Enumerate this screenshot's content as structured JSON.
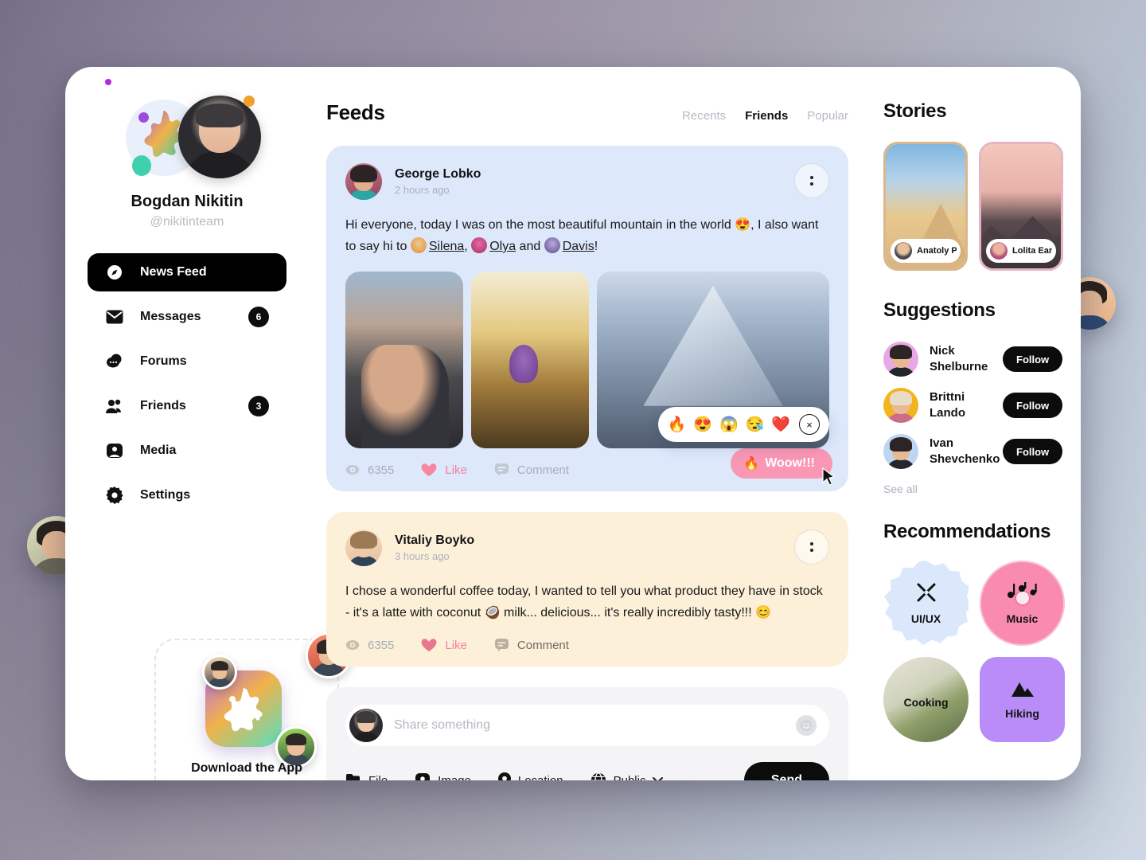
{
  "profile": {
    "name": "Bogdan Nikitin",
    "handle": "@nikitinteam"
  },
  "nav": {
    "items": [
      {
        "label": "News Feed",
        "icon": "compass-icon",
        "badge": "",
        "active": true
      },
      {
        "label": "Messages",
        "icon": "mail-icon",
        "badge": "6",
        "active": false
      },
      {
        "label": "Forums",
        "icon": "chat-icon",
        "badge": "",
        "active": false
      },
      {
        "label": "Friends",
        "icon": "people-icon",
        "badge": "3",
        "active": false
      },
      {
        "label": "Media",
        "icon": "image-icon",
        "badge": "",
        "active": false
      },
      {
        "label": "Settings",
        "icon": "gear-icon",
        "badge": "",
        "active": false
      }
    ]
  },
  "download_card": {
    "title": "Download the App",
    "icon": "app-logo-splash-icon"
  },
  "feed": {
    "title": "Feeds",
    "tabs": [
      {
        "label": "Recents",
        "active": false
      },
      {
        "label": "Friends",
        "active": true
      },
      {
        "label": "Popular",
        "active": false
      }
    ],
    "posts": [
      {
        "author": "George Lobko",
        "time": "2 hours ago",
        "text_part1": "Hi everyone, today I was on the most beautiful mountain in the world ",
        "emoji1": "😍",
        "text_part2": ", I also want to say hi to ",
        "mention1": "Silena",
        "text_part3": ", ",
        "mention2": "Olya",
        "text_part4": " and ",
        "mention3": "Davis",
        "text_part5": "!",
        "views": "6355",
        "like_label": "Like",
        "comment_label": "Comment",
        "has_gallery": true,
        "reactions": [
          "🔥",
          "😍",
          "😱",
          "😪",
          "❤️"
        ],
        "reaction_close": "×",
        "woow_label": "Woow!!!",
        "woow_emoji": "🔥"
      },
      {
        "author": "Vitaliy Boyko",
        "time": "3 hours ago",
        "text_line1": "I chose a wonderful coffee today, I wanted to tell you what product they have",
        "text_line2_a": "in stock - it's a latte with coconut ",
        "text_line2_emoji": "🥥",
        "text_line2_b": " milk... delicious... it's really incredibly",
        "text_line3": "tasty!!! ",
        "text_line3_emoji": "😊",
        "views": "6355",
        "like_label": "Like",
        "comment_label": "Comment",
        "has_gallery": false
      }
    ]
  },
  "composer": {
    "placeholder": "Share something",
    "value": "",
    "smiley_icon": "smiley-icon",
    "tools": [
      {
        "label": "File",
        "icon": "file-icon"
      },
      {
        "label": "Image",
        "icon": "image-icon"
      },
      {
        "label": "Location",
        "icon": "location-pin-icon"
      }
    ],
    "privacy": {
      "label": "Public",
      "icon": "globe-icon",
      "chevron": "chevron-down-icon"
    },
    "send_label": "Send"
  },
  "stories": {
    "title": "Stories",
    "items": [
      {
        "name": "Anatoly Pr...",
        "theme": "desert"
      },
      {
        "name": "Lolita Earns",
        "theme": "mountain-sunset"
      }
    ]
  },
  "suggestions": {
    "title": "Suggestions",
    "see_all": "See all",
    "items": [
      {
        "first": "Nick",
        "last": "Shelburne",
        "action": "Follow"
      },
      {
        "first": "Brittni",
        "last": "Lando",
        "action": "Follow"
      },
      {
        "first": "Ivan",
        "last": "Shevchenko",
        "action": "Follow"
      }
    ]
  },
  "recommendations": {
    "title": "Recommendations",
    "items": [
      {
        "label": "UI/UX",
        "icon": "pen-cross-icon"
      },
      {
        "label": "Music",
        "icon": "music-notes-icon"
      },
      {
        "label": "Cooking",
        "icon": "cooking-photo"
      },
      {
        "label": "Hiking",
        "icon": "mountain-icon"
      }
    ]
  },
  "colors": {
    "accent_dark": "#0c0c0c",
    "post_blue": "#dde8fb",
    "post_cream": "#fdf0d9",
    "like_pink": "#f2809f",
    "woow_pink": "#f997b5",
    "muted": "#adb2bd"
  }
}
